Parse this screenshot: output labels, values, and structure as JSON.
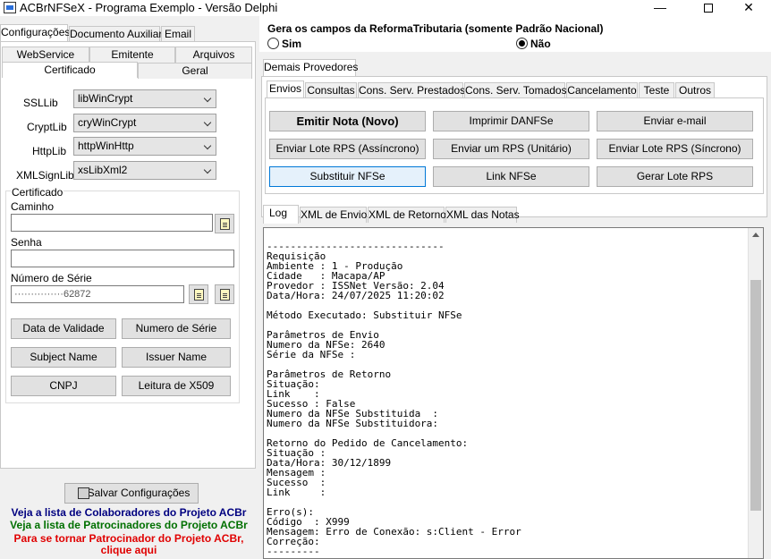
{
  "window": {
    "title": "ACBrNFSeX - Programa Exemplo - Versão Delphi",
    "minimize": "—",
    "close": "✕"
  },
  "left": {
    "tabs": [
      "Configurações",
      "Documento Auxiliar",
      "Email"
    ],
    "subtabs_row1": [
      "WebService",
      "Emitente",
      "Arquivos"
    ],
    "subtabs_row2": [
      "Certificado",
      "Geral"
    ],
    "fields": {
      "ssllib_label": "SSLLib",
      "ssllib_value": "libWinCrypt",
      "cryptlib_label": "CryptLib",
      "cryptlib_value": "cryWinCrypt",
      "httplib_label": "HttpLib",
      "httplib_value": "httpWinHttp",
      "xmlsignlib_label": "XMLSignLib",
      "xmlsignlib_value": "xsLibXml2"
    },
    "certificado": {
      "group_title": "Certificado",
      "caminho_label": "Caminho",
      "caminho_value": "",
      "senha_label": "Senha",
      "senha_value": "",
      "numero_serie_label": "Número de Série",
      "numero_serie_value": "          ···············62872"
    },
    "buttons": {
      "data_validade": "Data de Validade",
      "numero_serie": "Numero de Série",
      "subject_name": "Subject Name",
      "issuer_name": "Issuer Name",
      "cnpj": "CNPJ",
      "leitura_x509": "Leitura de X509"
    },
    "salvar": "Salvar Configurações",
    "links": {
      "colaboradores": "Veja a lista de Colaboradores do Projeto ACBr",
      "patrocinadores": "Veja a lista de Patrocinadores do Projeto ACBr",
      "tornar_line1": "Para se tornar Patrocinador do Projeto ACBr,",
      "tornar_line2": "clique aqui"
    }
  },
  "right": {
    "reforma_title": "Gera os campos da ReformaTributaria (somente Padrão Nacional)",
    "reforma_sim": "Sim",
    "reforma_nao": "Não",
    "reforma_selected": "Não",
    "provedores_tab": "Demais Provedores",
    "action_tabs": [
      "Envios",
      "Consultas",
      "Cons. Serv. Prestados",
      "Cons. Serv. Tomados",
      "Cancelamento",
      "Teste",
      "Outros"
    ],
    "action_buttons": {
      "emitir_nota": "Emitir Nota (Novo)",
      "imprimir_danfse": "Imprimir DANFSe",
      "enviar_email": "Enviar e-mail",
      "enviar_lote_assincrono": "Enviar Lote RPS (Assíncrono)",
      "enviar_um_rps": "Enviar um RPS (Unitário)",
      "enviar_lote_sincrono": "Enviar Lote RPS (Síncrono)",
      "substituir_nfse": "Substituir NFSe",
      "link_nfse": "Link NFSe",
      "gerar_lote_rps": "Gerar Lote RPS"
    },
    "log_tabs": [
      "Log",
      "XML de Envio",
      "XML de Retorno",
      "XML das Notas"
    ],
    "log_lines": [
      "",
      "------------------------------",
      "Requisição",
      "Ambiente : 1 - Produção",
      "Cidade   : Macapa/AP",
      "Provedor : ISSNet Versão: 2.04",
      "Data/Hora: 24/07/2025 11:20:02",
      "",
      "Método Executado: Substituir NFSe",
      "",
      "Parâmetros de Envio",
      "Numero da NFSe: 2640",
      "Série da NFSe :",
      "",
      "Parâmetros de Retorno",
      "Situação:",
      "Link    :",
      "Sucesso : False",
      "Numero da NFSe Substituida  :",
      "Numero da NFSe Substituidora:",
      "",
      "Retorno do Pedido de Cancelamento:",
      "Situação :",
      "Data/Hora: 30/12/1899",
      "Mensagem :",
      "Sucesso  :",
      "Link     :",
      "",
      "Erro(s):",
      "Código  : X999",
      "Mensagem: Erro de Conexão: s:Client - Error",
      "Correção:",
      "---------"
    ]
  },
  "colors": {
    "link_blue": "#000080",
    "link_green": "#007000",
    "link_red": "#e00000",
    "focus_border": "#0078d7"
  }
}
